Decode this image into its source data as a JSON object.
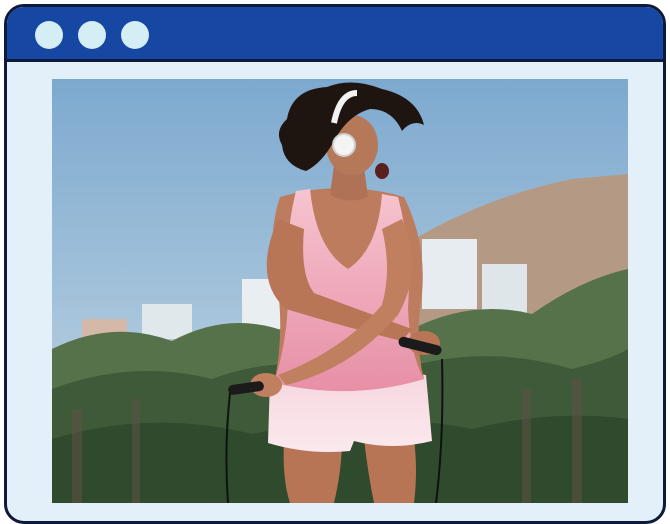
{
  "window": {
    "titlebar_color": "#1647a3",
    "border_color": "#0d1a3a",
    "body_color": "#e3eff9",
    "controls": [
      "window-dot",
      "window-dot",
      "window-dot"
    ]
  },
  "content": {
    "image_subject": "photo-woman-jump-rope-headphones"
  }
}
